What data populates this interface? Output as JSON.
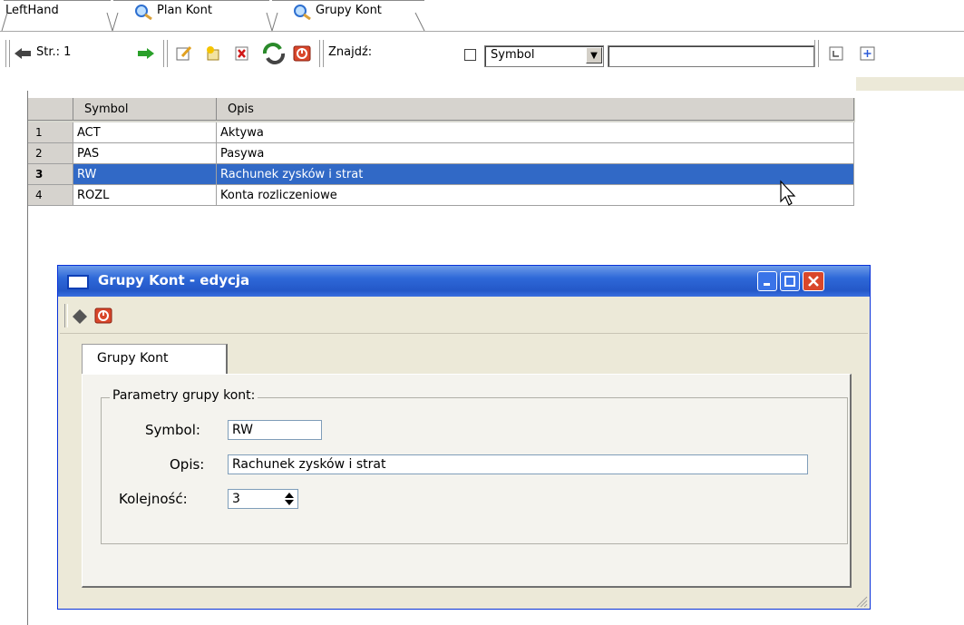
{
  "tabs": [
    {
      "label": "LeftHand",
      "icon": ""
    },
    {
      "label": "Plan Kont",
      "icon": "magnifier-icon"
    },
    {
      "label": "Grupy Kont",
      "icon": "magnifier-icon"
    }
  ],
  "toolbar": {
    "page_label": "Str.: 1",
    "find_label": "Znajdź:",
    "field_select": "Symbol",
    "search_value": ""
  },
  "grid": {
    "columns": [
      "Symbol",
      "Opis"
    ],
    "rows": [
      {
        "num": "1",
        "symbol": "ACT",
        "opis": "Aktywa",
        "selected": false
      },
      {
        "num": "2",
        "symbol": "PAS",
        "opis": "Pasywa",
        "selected": false
      },
      {
        "num": "3",
        "symbol": "RW",
        "opis": "Rachunek zysków i strat",
        "selected": true
      },
      {
        "num": "4",
        "symbol": "ROZL",
        "opis": "Konta rozliczeniowe",
        "selected": false
      }
    ]
  },
  "dialog": {
    "title": "Grupy Kont - edycja",
    "tab": "Grupy Kont",
    "group_label": "Parametry grupy kont:",
    "symbol_label": "Symbol:",
    "symbol_value": "RW",
    "opis_label": "Opis:",
    "opis_value": "Rachunek zysków i strat",
    "kolejnosc_label": "Kolejność:",
    "kolejnosc_value": "3"
  },
  "colors": {
    "selection": "#3169c6",
    "titlebar": "#2458c8",
    "close": "#d9472b"
  }
}
